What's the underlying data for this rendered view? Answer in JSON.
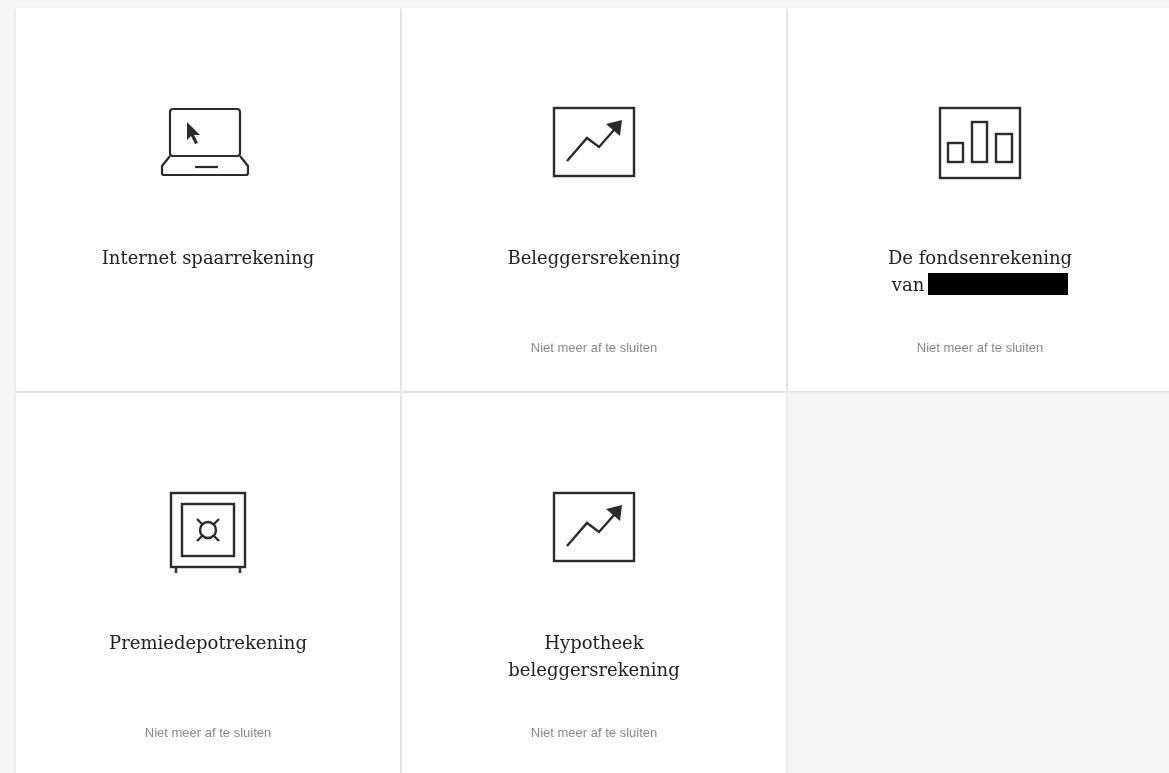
{
  "cards": [
    {
      "kind": "laptop",
      "title": "Internet spaarrekening",
      "redacted": false
    },
    {
      "kind": "chart",
      "title": "Beleggersrekening",
      "note": "Niet meer af te sluiten",
      "redacted": false
    },
    {
      "kind": "bars",
      "title": "De fondsenrekening van",
      "note": "Niet meer af te sluiten",
      "redacted": true
    },
    {
      "kind": "safe",
      "title": "Premiedepotrekening",
      "note": "Niet meer af te sluiten",
      "redacted": false
    },
    {
      "kind": "chart",
      "title": "Hypotheek beleggersrekening",
      "note": "Niet meer af te sluiten",
      "redacted": false
    }
  ]
}
